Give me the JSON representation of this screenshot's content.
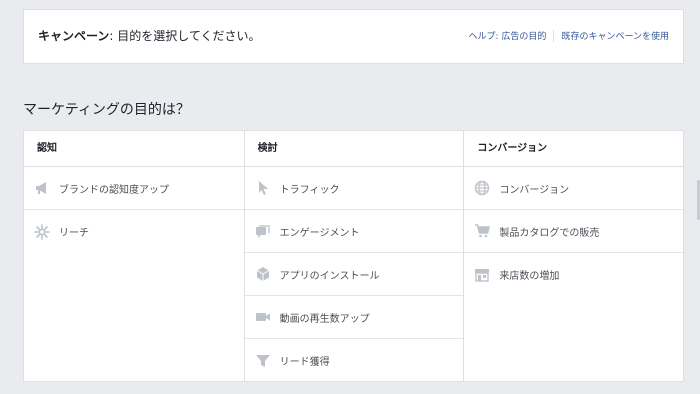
{
  "header": {
    "campaign_label": "キャンペーン",
    "campaign_text": ": 目的を選択してください。",
    "help_link": "ヘルプ: 広告の目的",
    "existing_link": "既存のキャンペーンを使用"
  },
  "question": "マーケティングの目的は？",
  "columns": [
    {
      "title": "認知",
      "items": [
        {
          "label": "ブランドの認知度アップ",
          "icon": "megaphone-icon"
        },
        {
          "label": "リーチ",
          "icon": "reach-icon"
        }
      ]
    },
    {
      "title": "検討",
      "items": [
        {
          "label": "トラフィック",
          "icon": "cursor-icon"
        },
        {
          "label": "エンゲージメント",
          "icon": "chat-bubbles-icon"
        },
        {
          "label": "アプリのインストール",
          "icon": "cube-icon"
        },
        {
          "label": "動画の再生数アップ",
          "icon": "video-camera-icon"
        },
        {
          "label": "リード獲得",
          "icon": "funnel-icon"
        }
      ]
    },
    {
      "title": "コンバージョン",
      "items": [
        {
          "label": "コンバージョン",
          "icon": "globe-icon"
        },
        {
          "label": "製品カタログでの販売",
          "icon": "shopping-cart-icon"
        },
        {
          "label": "来店数の増加",
          "icon": "store-icon"
        }
      ]
    }
  ],
  "colors": {
    "link": "#365899",
    "icon": "#bec3c9",
    "background": "#e9ebee"
  }
}
